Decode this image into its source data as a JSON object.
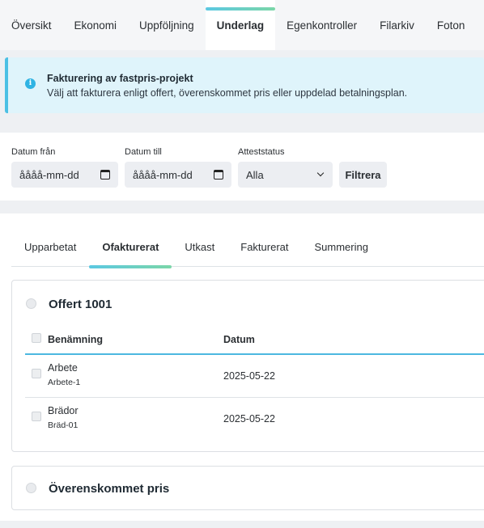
{
  "top_tabs": [
    {
      "label": "Översikt"
    },
    {
      "label": "Ekonomi"
    },
    {
      "label": "Uppföljning"
    },
    {
      "label": "Underlag"
    },
    {
      "label": "Egenkontroller"
    },
    {
      "label": "Filarkiv"
    },
    {
      "label": "Foton"
    }
  ],
  "active_top_tab": "Underlag",
  "info": {
    "icon": "info-icon",
    "glyph": "i",
    "title": "Fakturering av fastpris-projekt",
    "text": "Välj att fakturera enligt offert, överenskommet pris eller uppdelad betalningsplan."
  },
  "filters": {
    "date_from": {
      "label": "Datum från",
      "value": "åååå-mm-dd"
    },
    "date_to": {
      "label": "Datum till",
      "value": "åååå-mm-dd"
    },
    "status": {
      "label": "Atteststatus",
      "value": "Alla"
    },
    "button": "Filtrera"
  },
  "sub_tabs": [
    {
      "label": "Upparbetat"
    },
    {
      "label": "Ofakturerat"
    },
    {
      "label": "Utkast"
    },
    {
      "label": "Fakturerat"
    },
    {
      "label": "Summering"
    }
  ],
  "active_sub_tab": "Ofakturerat",
  "offer_card": {
    "title": "Offert 1001",
    "columns": {
      "name": "Benämning",
      "date": "Datum"
    },
    "rows": [
      {
        "name": "Arbete",
        "code": "Arbete-1",
        "date": "2025-05-22"
      },
      {
        "name": "Brädor",
        "code": "Bräd-01",
        "date": "2025-05-22"
      }
    ]
  },
  "agreed_card": {
    "title": "Överenskommet pris"
  },
  "colors": {
    "accent": "#4cb8e0",
    "info_bg": "#dff4fb",
    "tab_gradient_start": "#5bc8e2",
    "tab_gradient_end": "#7bd6a8"
  }
}
